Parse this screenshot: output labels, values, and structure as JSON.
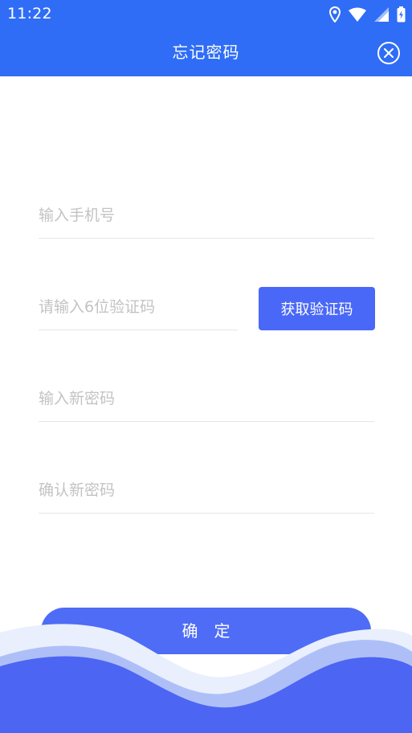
{
  "status_bar": {
    "time": "11:22",
    "icons": [
      "location-icon",
      "wifi-icon",
      "signal-icon",
      "battery-charging-icon"
    ]
  },
  "app_bar": {
    "title": "忘记密码",
    "close_icon": "close-circle-icon"
  },
  "form": {
    "phone_placeholder": "输入手机号",
    "code_placeholder": "请输入6位验证码",
    "get_code_label": "获取验证码",
    "new_password_placeholder": "输入新密码",
    "confirm_password_placeholder": "确认新密码",
    "confirm_label": "确定"
  },
  "colors": {
    "primary": "#2f6df6",
    "button": "#4a68f7",
    "placeholder": "#c3c3c3",
    "divider": "#e6e6e6"
  }
}
